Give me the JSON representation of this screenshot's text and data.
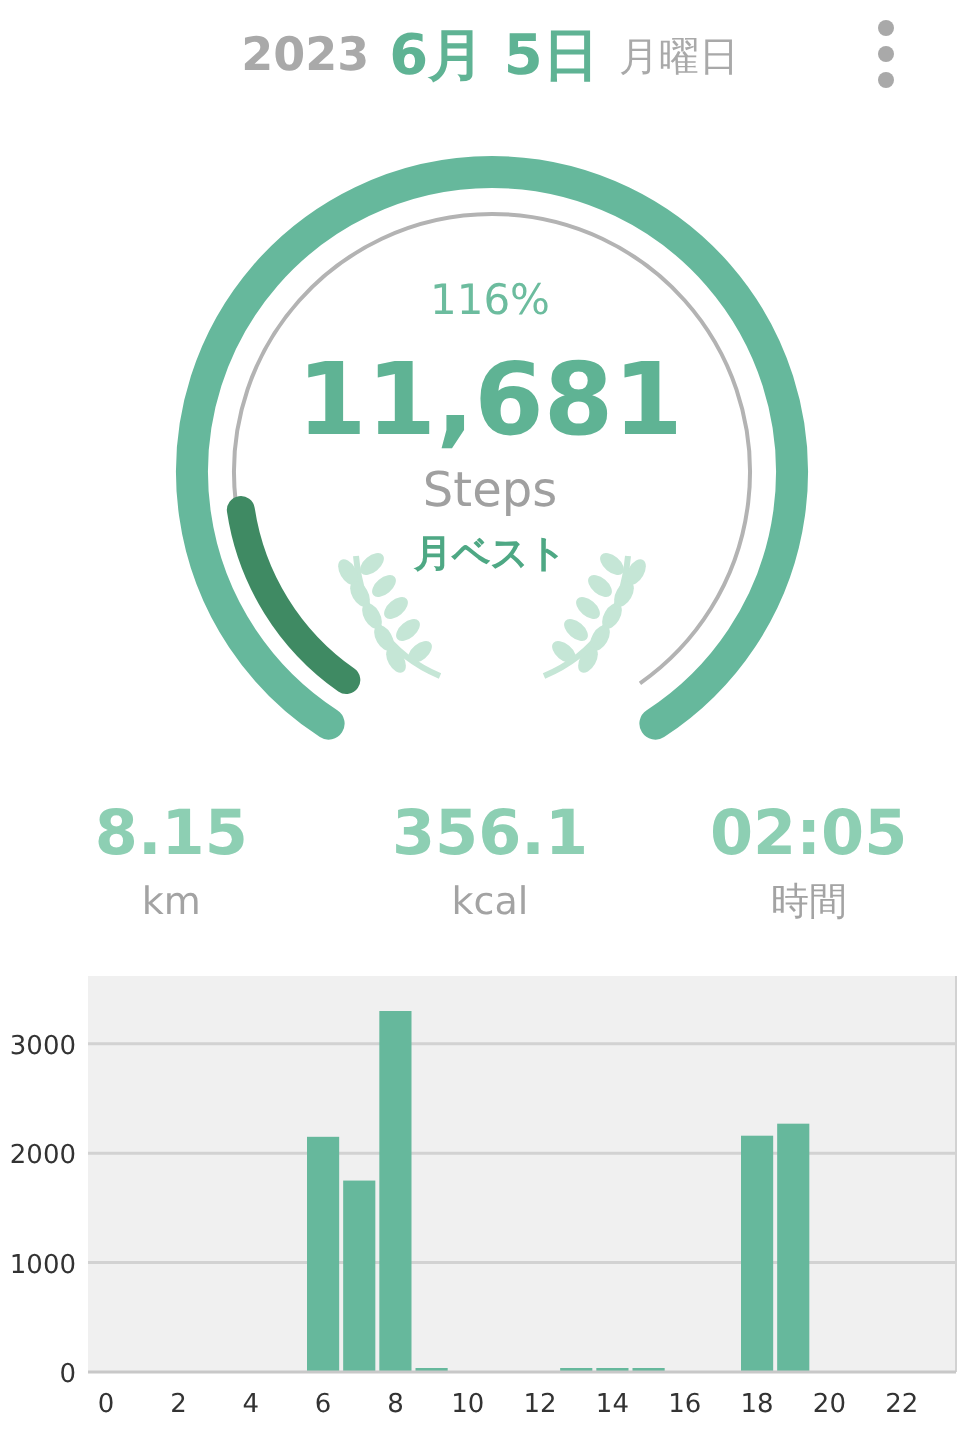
{
  "header": {
    "year": "2023",
    "date": "6月 5日",
    "weekday": "月曜日"
  },
  "ring": {
    "percent": "116%",
    "steps": "11,681",
    "unit": "Steps",
    "badge": "月ベスト"
  },
  "stats": [
    {
      "value": "8.15",
      "label": "km"
    },
    {
      "value": "356.1",
      "label": "kcal"
    },
    {
      "value": "02:05",
      "label": "時間"
    }
  ],
  "chart_data": {
    "type": "bar",
    "x": [
      6,
      7,
      8,
      9,
      13,
      14,
      15,
      18,
      19
    ],
    "series": [
      {
        "color": "#66b89c",
        "values": [
          2150,
          1750,
          3300,
          20,
          20,
          10,
          10,
          2160,
          2270
        ]
      }
    ],
    "xlim": [
      -0.5,
      23.5
    ],
    "xticks": [
      0,
      2,
      4,
      6,
      8,
      10,
      12,
      14,
      16,
      18,
      20,
      22
    ],
    "yticks": [
      0,
      1000,
      2000,
      3000
    ],
    "ylim": [
      0,
      3620
    ],
    "grid": true
  }
}
